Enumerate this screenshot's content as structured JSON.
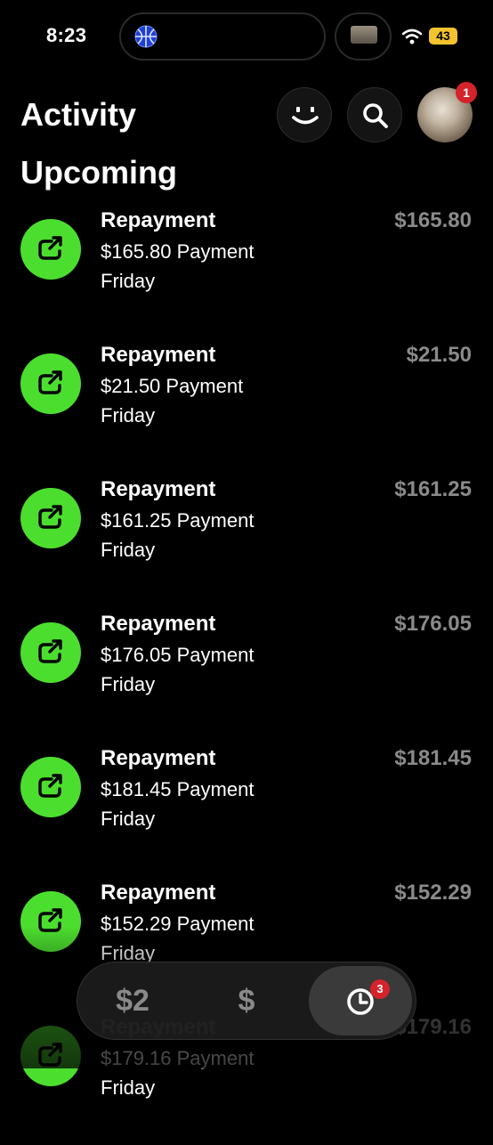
{
  "status_bar": {
    "time": "8:23",
    "battery": "43",
    "wifi_icon": "wifi-icon",
    "island_icon": "basketball-icon"
  },
  "header": {
    "title": "Activity",
    "smile_icon": "smile-icon",
    "search_icon": "search-icon",
    "notification_count": "1"
  },
  "section": {
    "title": "Upcoming"
  },
  "items": [
    {
      "title": "Repayment",
      "subtitle": "$165.80 Payment",
      "day": "Friday",
      "amount": "$165.80"
    },
    {
      "title": "Repayment",
      "subtitle": "$21.50 Payment",
      "day": "Friday",
      "amount": "$21.50"
    },
    {
      "title": "Repayment",
      "subtitle": "$161.25 Payment",
      "day": "Friday",
      "amount": "$161.25"
    },
    {
      "title": "Repayment",
      "subtitle": "$176.05 Payment",
      "day": "Friday",
      "amount": "$176.05"
    },
    {
      "title": "Repayment",
      "subtitle": "$181.45 Payment",
      "day": "Friday",
      "amount": "$181.45"
    },
    {
      "title": "Repayment",
      "subtitle": "$152.29 Payment",
      "day": "Friday",
      "amount": "$152.29"
    },
    {
      "title": "Repayment",
      "subtitle": "$179.16 Payment",
      "day": "Friday",
      "amount": "$179.16"
    }
  ],
  "tabbar": {
    "tabs": [
      {
        "label": "$2",
        "name": "tab-cash"
      },
      {
        "label": "$",
        "name": "tab-money"
      },
      {
        "label": "",
        "name": "tab-activity"
      }
    ],
    "activity_badge": "3",
    "activity_icon": "clock-icon"
  },
  "colors": {
    "accent_green": "#4cde2f",
    "badge_red": "#d4232b",
    "amount_gray": "#8a8a8a"
  }
}
